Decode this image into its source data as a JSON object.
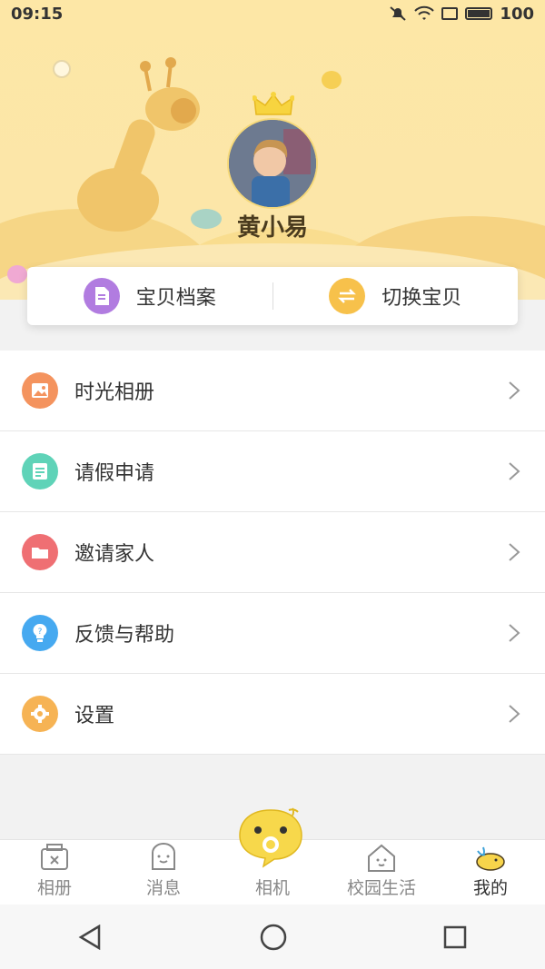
{
  "status_bar": {
    "time": "09:15",
    "battery": "100"
  },
  "profile": {
    "name": "黄小易"
  },
  "actions": [
    {
      "label": "宝贝档案",
      "icon": "document-icon",
      "color": "#b17ce0"
    },
    {
      "label": "切换宝贝",
      "icon": "swap-icon",
      "color": "#f7c14b"
    }
  ],
  "menu": [
    {
      "label": "时光相册",
      "icon": "photo-icon",
      "color": "#f4935e"
    },
    {
      "label": "请假申请",
      "icon": "form-icon",
      "color": "#5fd3b8"
    },
    {
      "label": "邀请家人",
      "icon": "folder-icon",
      "color": "#ef6f73"
    },
    {
      "label": "反馈与帮助",
      "icon": "lightbulb-icon",
      "color": "#46a9f0"
    },
    {
      "label": "设置",
      "icon": "gear-icon",
      "color": "#f6b354"
    }
  ],
  "tabs": [
    {
      "label": "相册",
      "icon": "album-icon"
    },
    {
      "label": "消息",
      "icon": "message-icon"
    },
    {
      "label": "相机",
      "icon": "camera-icon"
    },
    {
      "label": "校园生活",
      "icon": "house-icon"
    },
    {
      "label": "我的",
      "icon": "whale-icon",
      "active": true
    }
  ],
  "colors": {
    "header_bg": "#fde7a6",
    "accent_yellow": "#f7d44b"
  }
}
